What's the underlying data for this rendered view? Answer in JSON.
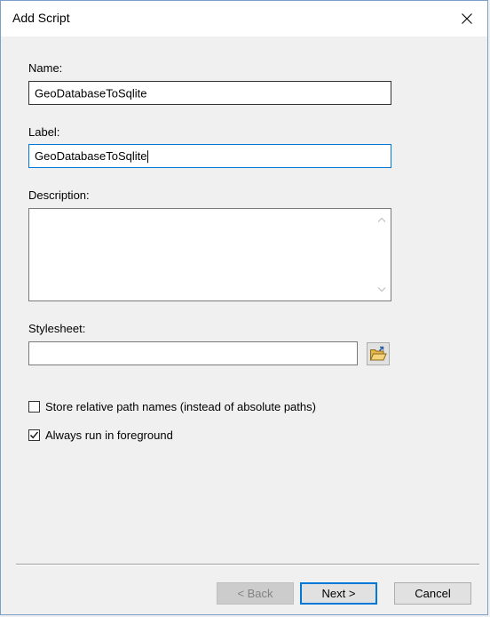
{
  "dialog": {
    "title": "Add Script"
  },
  "fields": {
    "name_label": "Name:",
    "name_value": "GeoDatabaseToSqlite",
    "label_label": "Label:",
    "label_value": "GeoDatabaseToSqlite",
    "description_label": "Description:",
    "description_value": "",
    "stylesheet_label": "Stylesheet:",
    "stylesheet_value": ""
  },
  "options": {
    "relative_paths_label": "Store relative path names (instead of absolute paths)",
    "relative_paths_checked": false,
    "foreground_label": "Always run in foreground",
    "foreground_checked": true
  },
  "buttons": {
    "back_label": "< Back",
    "next_label": "Next >",
    "cancel_label": "Cancel"
  },
  "icons": {
    "close": "close-icon",
    "browse": "folder-open-icon",
    "scroll_up": "chevron-up-icon",
    "scroll_down": "chevron-down-icon",
    "check": "checkmark-icon"
  },
  "colors": {
    "focus_border": "#0078d7",
    "window_border": "#7a9fc9",
    "folder_yellow": "#e8b64a"
  }
}
